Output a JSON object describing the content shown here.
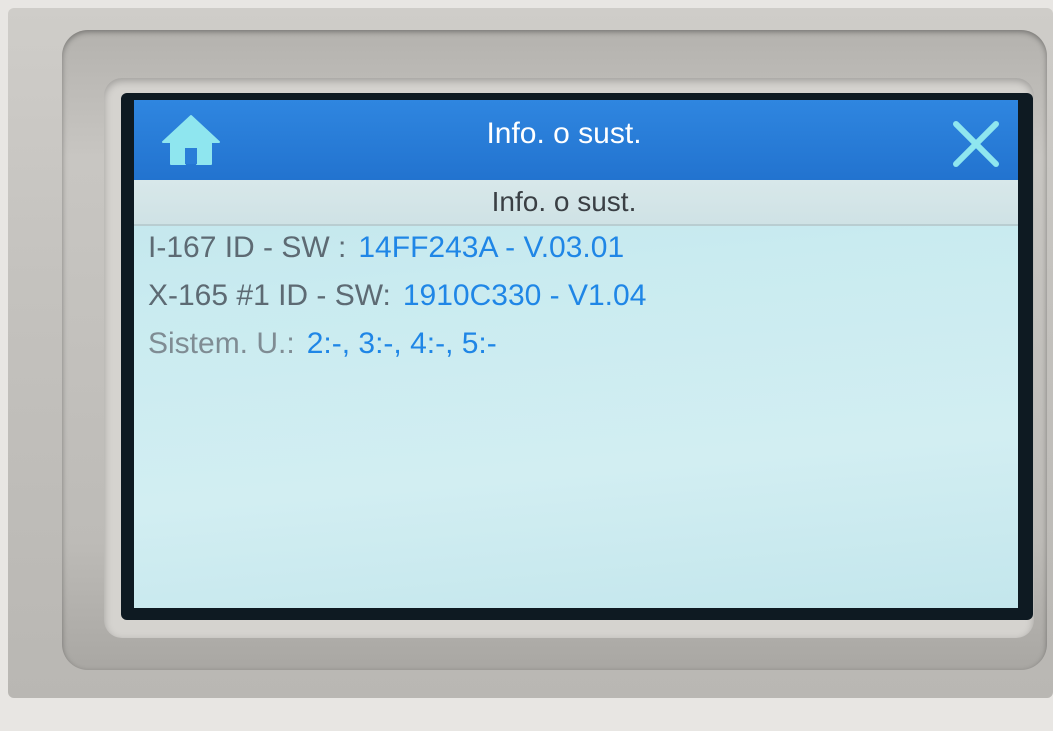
{
  "header": {
    "title": "Info. o sust.",
    "home_icon": "home-icon",
    "close_icon": "close-icon"
  },
  "section": {
    "title": "Info. o sust."
  },
  "info": [
    {
      "label": "I-167 ID - SW :",
      "value": "14FF243A - V.03.01"
    },
    {
      "label": "X-165 #1 ID - SW:",
      "value": "1910C330 - V1.04"
    },
    {
      "label": "Sistem. U.:",
      "value": "2:-, 3:-, 4:-, 5:-"
    }
  ],
  "colors": {
    "titlebar": "#2273cf",
    "value_text": "#1f86e6",
    "label_text": "#5d6a73",
    "screen_bg": "#c9ebf0"
  }
}
